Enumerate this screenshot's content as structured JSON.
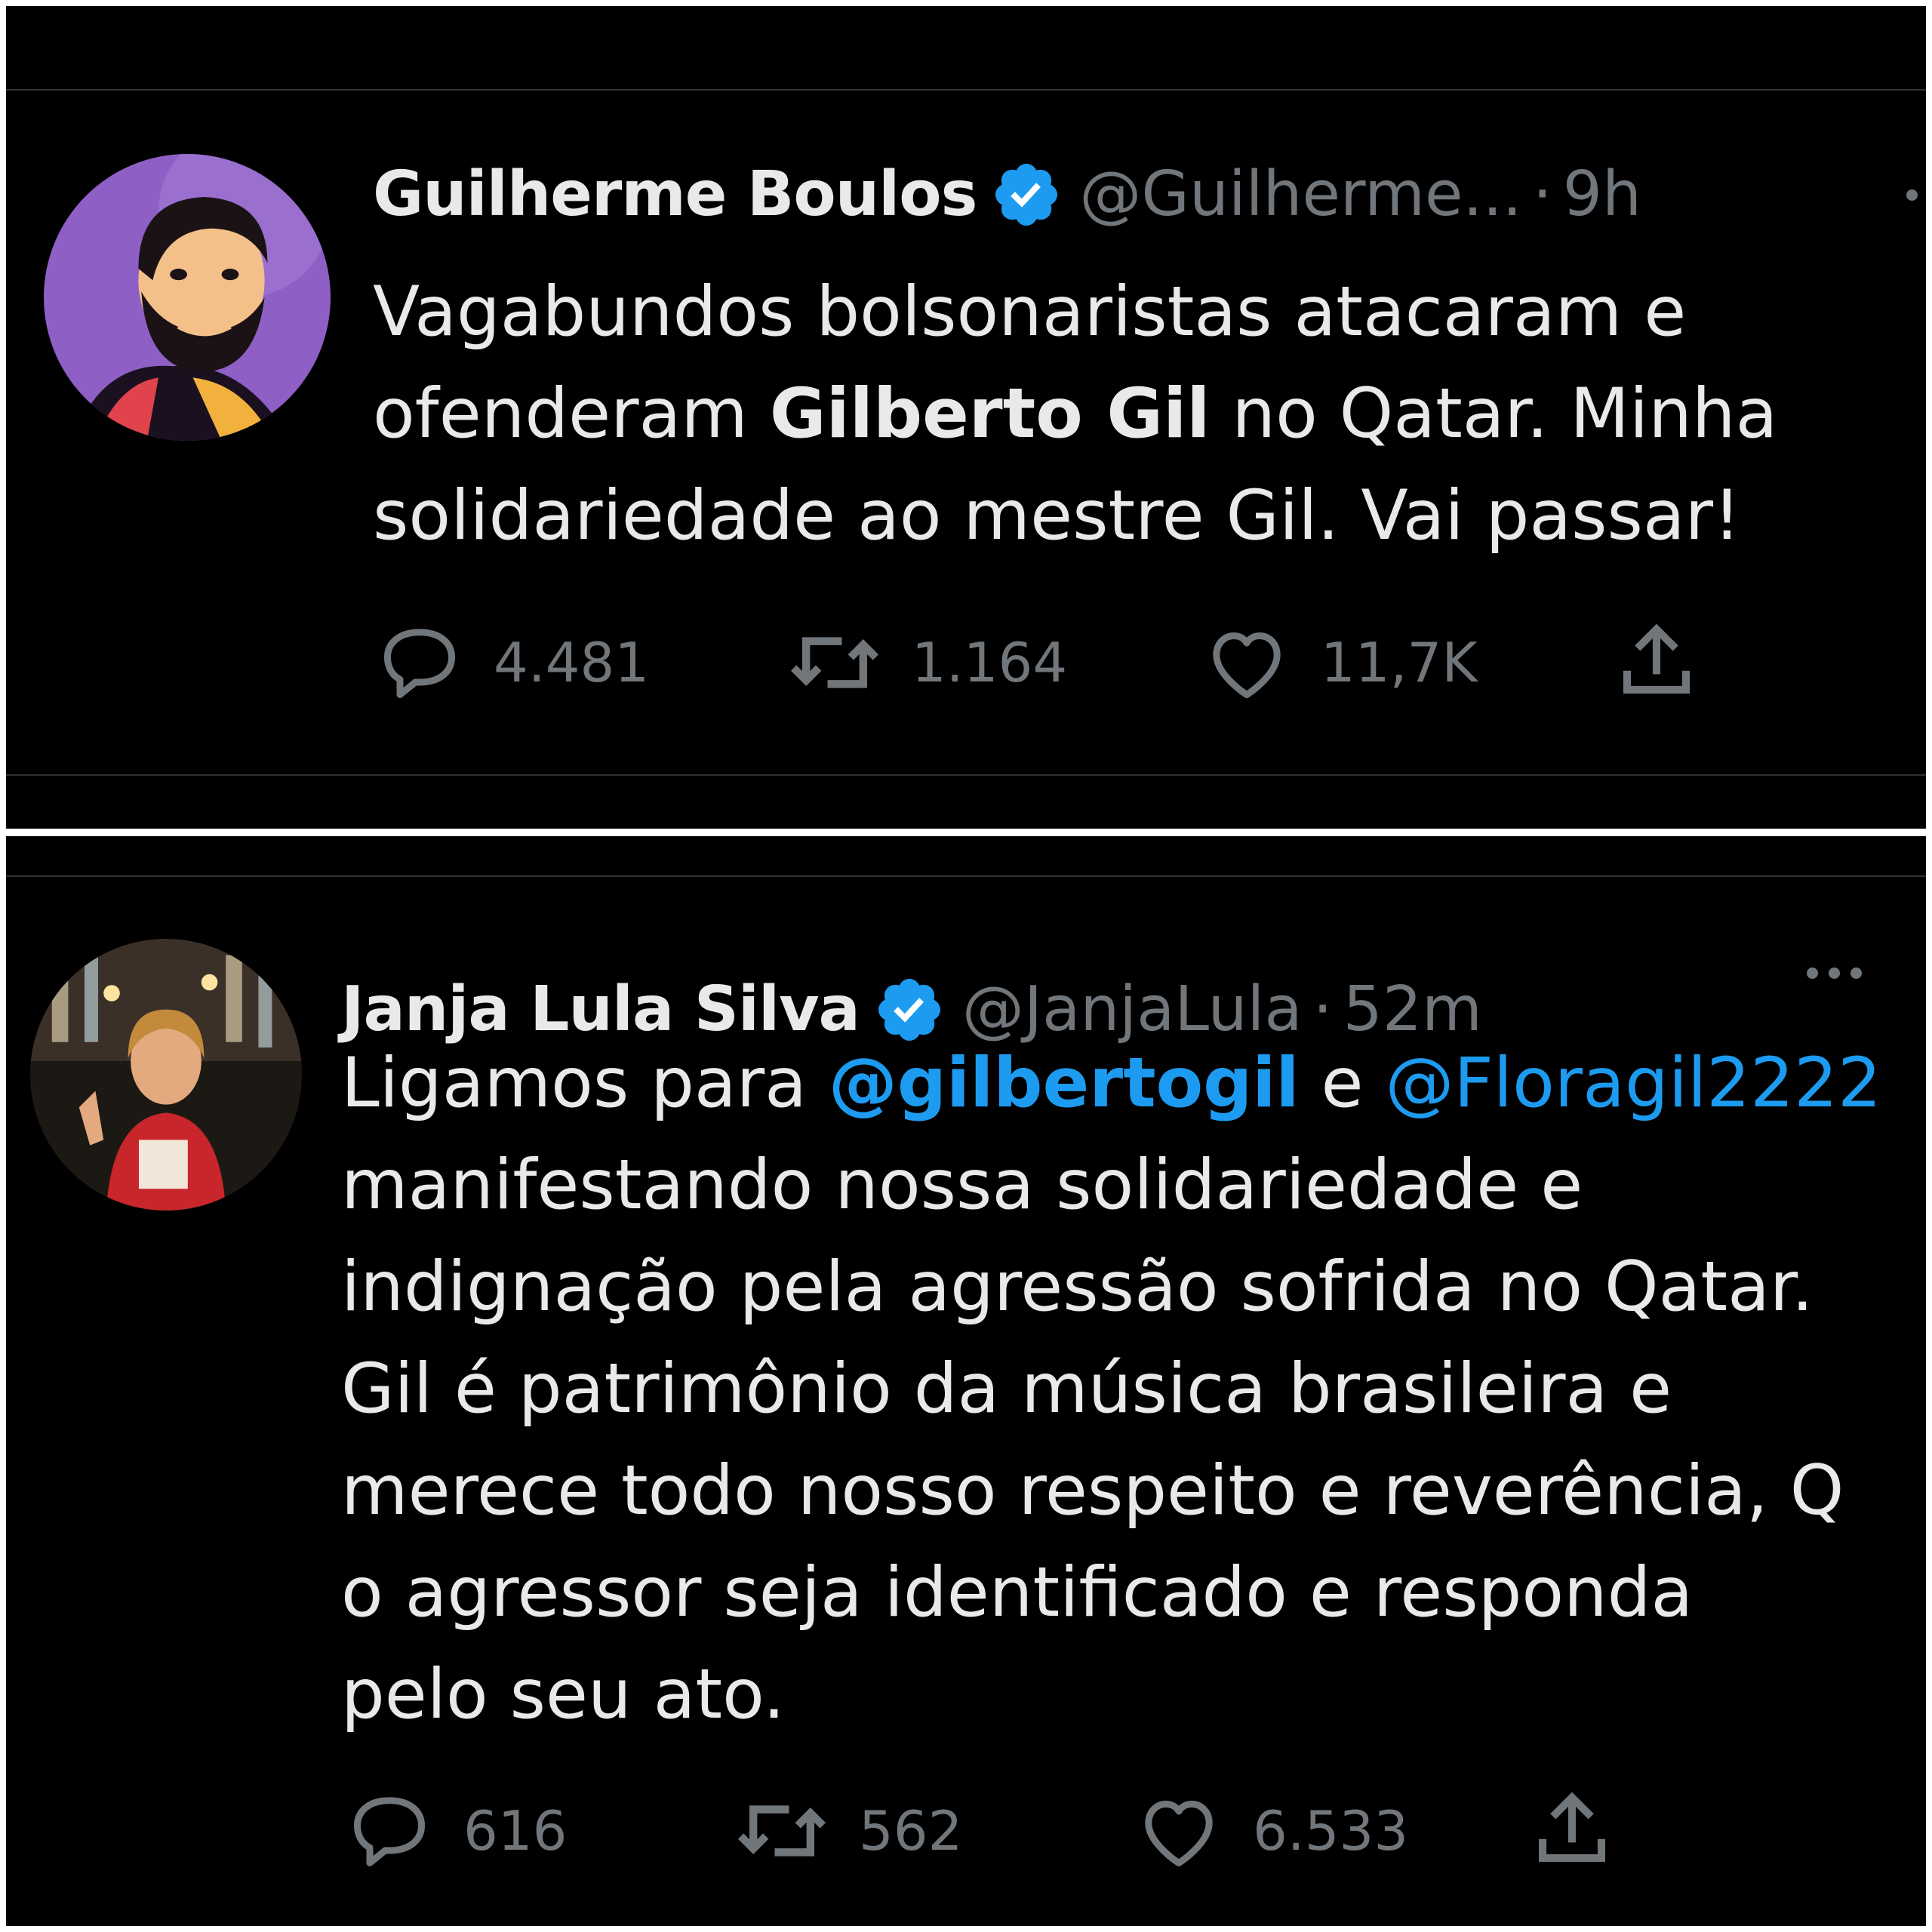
{
  "tweets": [
    {
      "name": "Guilherme Boulos",
      "handle": "@Guilherme...",
      "separator": "·",
      "time": "9h",
      "lines": [
        {
          "before": "Vagabundos bolsonaristas atacaram e"
        },
        {
          "before": "ofenderam ",
          "bold": "Gilberto Gil",
          "after": " no Qatar. Minha"
        },
        {
          "before": "solidariedade ao mestre Gil. Vai passar!"
        }
      ],
      "replies": "4.481",
      "retweets": "1.164",
      "likes": "11,7K",
      "avatar": "illustrated-portrait-bearded-man-purple-background"
    },
    {
      "name": "Janja Lula Silva",
      "handle": "@JanjaLula",
      "separator": "·",
      "time": "52m",
      "lines": [
        {
          "before": "Ligamos para ",
          "mention1": "@gilbertogil",
          "middle": " e ",
          "mention2": "@Floragil2222"
        },
        {
          "before": "manifestando nossa solidariedade e"
        },
        {
          "before": "indignação pela agressão sofrida no Qatar."
        },
        {
          "before": "Gil é patrimônio da música brasileira e"
        },
        {
          "before": "merece todo nosso respeito e reverência, Q"
        },
        {
          "before": "o agressor seja identificado e responda"
        },
        {
          "before": "pelo seu ato."
        }
      ],
      "replies": "616",
      "retweets": "562",
      "likes": "6.533",
      "avatar": "photo-woman-red-tshirt-city-lights"
    }
  ],
  "colors": {
    "background": "#000000",
    "text": "#e7e9ea",
    "secondary": "#71767b",
    "accent": "#1d9bf0"
  },
  "icons": [
    "verified-badge-icon",
    "reply-icon",
    "retweet-icon",
    "like-icon",
    "share-icon",
    "more-icon"
  ]
}
